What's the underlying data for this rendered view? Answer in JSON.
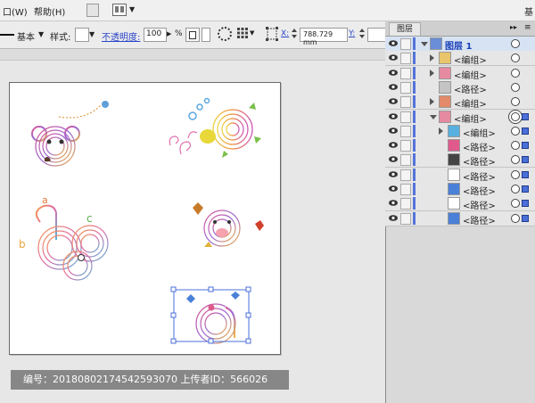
{
  "menubar": {
    "items": [
      "口(W)",
      "帮助(H)"
    ],
    "right_label": "基"
  },
  "controlbar": {
    "stroke_style": "基本",
    "style_label": "样式:",
    "opacity_label": "不透明度:",
    "opacity_value": "100",
    "opacity_unit": "%",
    "x_label": "X:",
    "x_value": "788.729 mm",
    "y_label": "Y:"
  },
  "layers_panel": {
    "tab_label": "图层",
    "rows": [
      {
        "label": "图层 1",
        "indent": 0,
        "expand": "down",
        "selected": true,
        "target": "single",
        "sel_square": false
      },
      {
        "label": "<编组>",
        "indent": 1,
        "expand": "right",
        "selected": false,
        "target": "single",
        "sel_square": false
      },
      {
        "label": "<编组>",
        "indent": 1,
        "expand": "right",
        "selected": false,
        "target": "single",
        "sel_square": false
      },
      {
        "label": "<路径>",
        "indent": 1,
        "expand": "none",
        "selected": false,
        "target": "single",
        "sel_square": false
      },
      {
        "label": "<编组>",
        "indent": 1,
        "expand": "right",
        "selected": false,
        "target": "single",
        "sel_square": false
      },
      {
        "label": "<编组>",
        "indent": 1,
        "expand": "down",
        "selected": false,
        "target": "double",
        "sel_square": true
      },
      {
        "label": "<编组>",
        "indent": 2,
        "expand": "right",
        "selected": false,
        "target": "single",
        "sel_square": true
      },
      {
        "label": "<路径>",
        "indent": 2,
        "expand": "none",
        "selected": false,
        "target": "single",
        "sel_square": true
      },
      {
        "label": "<路径>",
        "indent": 2,
        "expand": "none",
        "selected": false,
        "target": "single",
        "sel_square": true
      },
      {
        "label": "<路径>",
        "indent": 2,
        "expand": "none",
        "selected": false,
        "target": "single",
        "sel_square": true
      },
      {
        "label": "<路径>",
        "indent": 2,
        "expand": "none",
        "selected": false,
        "target": "single",
        "sel_square": true
      },
      {
        "label": "<路径>",
        "indent": 2,
        "expand": "none",
        "selected": false,
        "target": "single",
        "sel_square": true
      },
      {
        "label": "<路径>",
        "indent": 2,
        "expand": "none",
        "selected": false,
        "target": "single",
        "sel_square": true
      }
    ]
  },
  "artwork": {
    "letters": [
      "a",
      "b",
      "c"
    ]
  },
  "watermark": {
    "text": "编号：20180802174542593070 上传者ID：566026"
  },
  "colors": {
    "selection_blue": "#4a6fd8",
    "panel_bg": "#d9d9d9",
    "artboard_bg": "#ffffff"
  }
}
